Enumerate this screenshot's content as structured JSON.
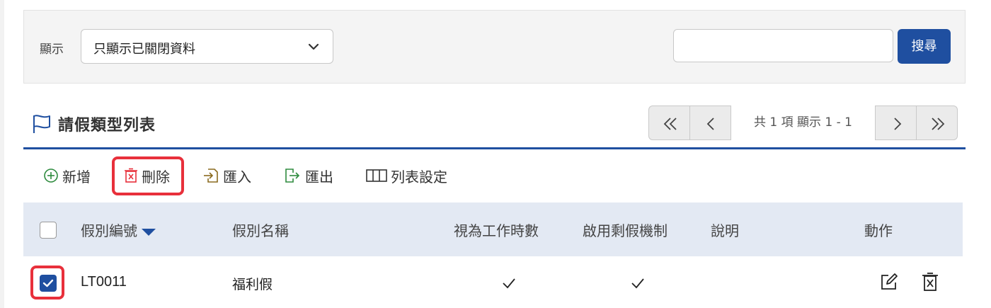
{
  "filter": {
    "label": "顯示",
    "select_value": "只顯示已關閉資料",
    "search_placeholder": "",
    "search_button": "搜尋"
  },
  "title": "請假類型列表",
  "pager": {
    "info": "共 1 項 顯示 1 - 1"
  },
  "toolbar": {
    "add": "新增",
    "delete": "刪除",
    "import": "匯入",
    "export": "匯出",
    "settings": "列表設定"
  },
  "table": {
    "headers": {
      "id": "假別編號",
      "name": "假別名稱",
      "count_as_work": "視為工作時數",
      "enable_remaining": "啟用剩假機制",
      "note": "說明",
      "actions": "動作"
    },
    "rows": [
      {
        "id": "LT0011",
        "name": "福利假",
        "count_as_work": true,
        "enable_remaining": true,
        "note": "",
        "selected": true
      }
    ]
  },
  "colors": {
    "primary": "#1f4fa0",
    "highlight": "#e8303b",
    "header_bg": "#e3e9f3"
  }
}
